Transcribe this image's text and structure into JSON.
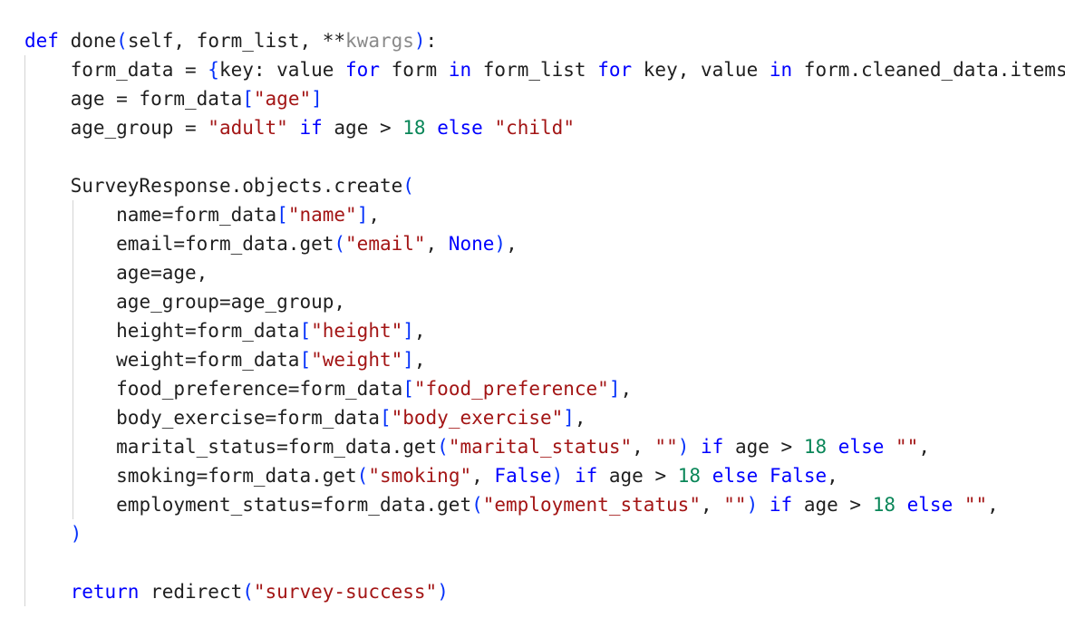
{
  "editor": {
    "lines": [
      {
        "indent": "",
        "tokens": [
          {
            "t": "def",
            "c": "kw"
          },
          {
            "t": " done"
          },
          {
            "t": "(",
            "c": "br"
          },
          {
            "t": "self, form_list, **"
          },
          {
            "t": "kwargs",
            "c": "dim"
          },
          {
            "t": ")",
            "c": "br"
          },
          {
            "t": ":"
          }
        ]
      },
      {
        "indent": "    ",
        "tokens": [
          {
            "t": "form_data = "
          },
          {
            "t": "{",
            "c": "br"
          },
          {
            "t": "key: value "
          },
          {
            "t": "for",
            "c": "kw"
          },
          {
            "t": " form "
          },
          {
            "t": "in",
            "c": "kw"
          },
          {
            "t": " form_list "
          },
          {
            "t": "for",
            "c": "kw"
          },
          {
            "t": " key, value "
          },
          {
            "t": "in",
            "c": "kw"
          },
          {
            "t": " form.cleaned_data.items()"
          }
        ]
      },
      {
        "indent": "    ",
        "tokens": [
          {
            "t": "age = form_data"
          },
          {
            "t": "[",
            "c": "br"
          },
          {
            "t": "\"age\"",
            "c": "str"
          },
          {
            "t": "]",
            "c": "br"
          }
        ]
      },
      {
        "indent": "    ",
        "tokens": [
          {
            "t": "age_group = "
          },
          {
            "t": "\"adult\"",
            "c": "str"
          },
          {
            "t": " "
          },
          {
            "t": "if",
            "c": "kw"
          },
          {
            "t": " age > "
          },
          {
            "t": "18",
            "c": "num"
          },
          {
            "t": " "
          },
          {
            "t": "else",
            "c": "kw"
          },
          {
            "t": " "
          },
          {
            "t": "\"child\"",
            "c": "str"
          }
        ]
      },
      {
        "indent": "",
        "tokens": []
      },
      {
        "indent": "    ",
        "tokens": [
          {
            "t": "SurveyResponse.objects.create"
          },
          {
            "t": "(",
            "c": "br"
          }
        ]
      },
      {
        "indent": "        ",
        "tokens": [
          {
            "t": "name=form_data"
          },
          {
            "t": "[",
            "c": "br"
          },
          {
            "t": "\"name\"",
            "c": "str"
          },
          {
            "t": "]",
            "c": "br"
          },
          {
            "t": ","
          }
        ]
      },
      {
        "indent": "        ",
        "tokens": [
          {
            "t": "email=form_data.get"
          },
          {
            "t": "(",
            "c": "br"
          },
          {
            "t": "\"email\"",
            "c": "str"
          },
          {
            "t": ", "
          },
          {
            "t": "None",
            "c": "kw"
          },
          {
            "t": ")",
            "c": "br"
          },
          {
            "t": ","
          }
        ]
      },
      {
        "indent": "        ",
        "tokens": [
          {
            "t": "age=age,"
          }
        ]
      },
      {
        "indent": "        ",
        "tokens": [
          {
            "t": "age_group=age_group,"
          }
        ]
      },
      {
        "indent": "        ",
        "tokens": [
          {
            "t": "height=form_data"
          },
          {
            "t": "[",
            "c": "br"
          },
          {
            "t": "\"height\"",
            "c": "str"
          },
          {
            "t": "]",
            "c": "br"
          },
          {
            "t": ","
          }
        ]
      },
      {
        "indent": "        ",
        "tokens": [
          {
            "t": "weight=form_data"
          },
          {
            "t": "[",
            "c": "br"
          },
          {
            "t": "\"weight\"",
            "c": "str"
          },
          {
            "t": "]",
            "c": "br"
          },
          {
            "t": ","
          }
        ]
      },
      {
        "indent": "        ",
        "tokens": [
          {
            "t": "food_preference=form_data"
          },
          {
            "t": "[",
            "c": "br"
          },
          {
            "t": "\"food_preference\"",
            "c": "str"
          },
          {
            "t": "]",
            "c": "br"
          },
          {
            "t": ","
          }
        ]
      },
      {
        "indent": "        ",
        "tokens": [
          {
            "t": "body_exercise=form_data"
          },
          {
            "t": "[",
            "c": "br"
          },
          {
            "t": "\"body_exercise\"",
            "c": "str"
          },
          {
            "t": "]",
            "c": "br"
          },
          {
            "t": ","
          }
        ]
      },
      {
        "indent": "        ",
        "tokens": [
          {
            "t": "marital_status=form_data.get"
          },
          {
            "t": "(",
            "c": "br"
          },
          {
            "t": "\"marital_status\"",
            "c": "str"
          },
          {
            "t": ", "
          },
          {
            "t": "\"\"",
            "c": "str"
          },
          {
            "t": ")",
            "c": "br"
          },
          {
            "t": " "
          },
          {
            "t": "if",
            "c": "kw"
          },
          {
            "t": " age > "
          },
          {
            "t": "18",
            "c": "num"
          },
          {
            "t": " "
          },
          {
            "t": "else",
            "c": "kw"
          },
          {
            "t": " "
          },
          {
            "t": "\"\"",
            "c": "str"
          },
          {
            "t": ","
          }
        ]
      },
      {
        "indent": "        ",
        "tokens": [
          {
            "t": "smoking=form_data.get"
          },
          {
            "t": "(",
            "c": "br"
          },
          {
            "t": "\"smoking\"",
            "c": "str"
          },
          {
            "t": ", "
          },
          {
            "t": "False",
            "c": "kw"
          },
          {
            "t": ")",
            "c": "br"
          },
          {
            "t": " "
          },
          {
            "t": "if",
            "c": "kw"
          },
          {
            "t": " age > "
          },
          {
            "t": "18",
            "c": "num"
          },
          {
            "t": " "
          },
          {
            "t": "else",
            "c": "kw"
          },
          {
            "t": " "
          },
          {
            "t": "False",
            "c": "kw"
          },
          {
            "t": ","
          }
        ]
      },
      {
        "indent": "        ",
        "tokens": [
          {
            "t": "employment_status=form_data.get"
          },
          {
            "t": "(",
            "c": "br"
          },
          {
            "t": "\"employment_status\"",
            "c": "str"
          },
          {
            "t": ", "
          },
          {
            "t": "\"\"",
            "c": "str"
          },
          {
            "t": ")",
            "c": "br"
          },
          {
            "t": " "
          },
          {
            "t": "if",
            "c": "kw"
          },
          {
            "t": " age > "
          },
          {
            "t": "18",
            "c": "num"
          },
          {
            "t": " "
          },
          {
            "t": "else",
            "c": "kw"
          },
          {
            "t": " "
          },
          {
            "t": "\"\"",
            "c": "str"
          },
          {
            "t": ","
          }
        ]
      },
      {
        "indent": "    ",
        "tokens": [
          {
            "t": ")",
            "c": "br"
          }
        ]
      },
      {
        "indent": "",
        "tokens": []
      },
      {
        "indent": "    ",
        "tokens": [
          {
            "t": "return",
            "c": "kw"
          },
          {
            "t": " redirect"
          },
          {
            "t": "(",
            "c": "br"
          },
          {
            "t": "\"survey-success\"",
            "c": "str"
          },
          {
            "t": ")",
            "c": "br"
          }
        ]
      }
    ]
  }
}
